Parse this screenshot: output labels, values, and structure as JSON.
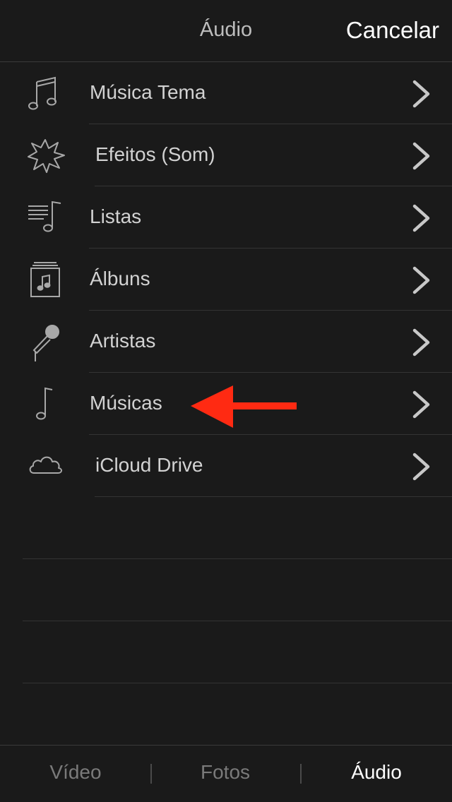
{
  "header": {
    "title": "Áudio",
    "cancel_label": "Cancelar"
  },
  "list": {
    "items": [
      {
        "label": "Música Tema",
        "icon": "music-notes-icon"
      },
      {
        "label": "Efeitos (Som)",
        "icon": "starburst-icon"
      },
      {
        "label": "Listas",
        "icon": "playlist-icon"
      },
      {
        "label": "Álbuns",
        "icon": "album-icon"
      },
      {
        "label": "Artistas",
        "icon": "microphone-icon"
      },
      {
        "label": "Músicas",
        "icon": "music-note-icon"
      },
      {
        "label": "iCloud Drive",
        "icon": "cloud-icon"
      }
    ]
  },
  "annotation": {
    "arrow_color": "#ff2a12"
  },
  "tabbar": {
    "tabs": [
      {
        "label": "Vídeo",
        "active": false
      },
      {
        "label": "Fotos",
        "active": false
      },
      {
        "label": "Áudio",
        "active": true
      }
    ]
  },
  "colors": {
    "background": "#1a1a1a",
    "text": "#d2d2d2",
    "icon": "#a8a8a8"
  }
}
